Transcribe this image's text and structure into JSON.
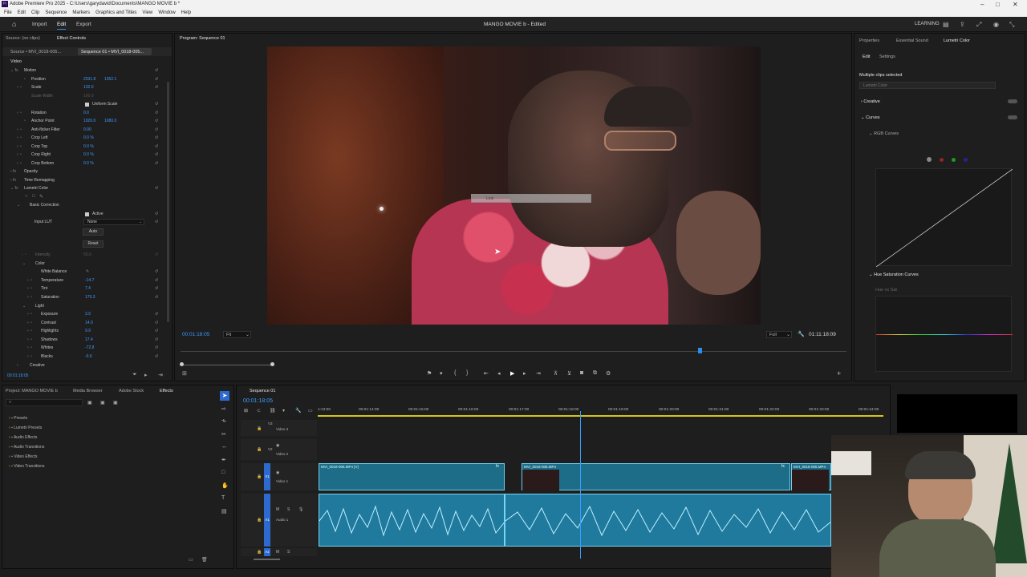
{
  "titlebar": {
    "title": "Adobe Premiere Pro 2025 - C:\\Users\\garydavid\\Documents\\MANGO MOVIE b *"
  },
  "menu": [
    "File",
    "Edit",
    "Clip",
    "Sequence",
    "Markers",
    "Graphics and Titles",
    "View",
    "Window",
    "Help"
  ],
  "appbar": {
    "import": "Import",
    "edit": "Edit",
    "export": "Export",
    "center_title": "MANGO MOVIE b - Edited",
    "learning": "LEARNING"
  },
  "source": {
    "tab_source": "Source: (no clips)",
    "tab_effects": "Effect Controls",
    "sub_source": "Source • MVI_0018-005...",
    "sub_seq": "Sequence 01 • MVI_0018-005...",
    "section_video": "Video"
  },
  "effects": {
    "motion": "Motion",
    "position": "Position",
    "position_x": "2331.8",
    "position_y": "1362.1",
    "scale": "Scale",
    "scale_val": "132.0",
    "scale_width": "Scale Width",
    "scale_width_val": "100.0",
    "uniform": "Uniform Scale",
    "rotation": "Rotation",
    "rotation_val": "0.0",
    "anchor": "Anchor Point",
    "anchor_x": "1920.0",
    "anchor_y": "1080.0",
    "flicker": "Anti-flicker Filter",
    "flicker_val": "0.00",
    "crop_left": "Crop Left",
    "crop_top": "Crop Top",
    "crop_right": "Crop Right",
    "crop_bottom": "Crop Bottom",
    "crop_val": "0.0 %",
    "opacity": "Opacity",
    "time_remap": "Time Remapping",
    "lumetri": "Lumetri Color",
    "basic": "Basic Correction",
    "active": "Active",
    "input_lut": "Input LUT",
    "lut_val": "None",
    "auto": "Auto",
    "reset": "Reset",
    "intensity": "Intensity",
    "intensity_val": "50.0",
    "color": "Color",
    "wb": "White Balance",
    "temperature": "Temperature",
    "temperature_val": "-14.7",
    "tint": "Tint",
    "tint_val": "7.4",
    "saturation": "Saturation",
    "saturation_val": "179.3",
    "light": "Light",
    "exposure": "Exposure",
    "exposure_val": "3.9",
    "contrast": "Contrast",
    "contrast_val": "14.0",
    "highlights": "Highlights",
    "highlights_val": "9.9",
    "shadows": "Shadows",
    "shadows_val": "17.4",
    "whites": "Whites",
    "whites_val": "-72.8",
    "blacks": "Blacks",
    "blacks_val": "-0.6",
    "creative": "Creative",
    "timecode": "00:01:18:05"
  },
  "program": {
    "tab": "Program: Sequence 01",
    "timecode": "00:01:18:05",
    "fit": "Fit",
    "full": "Full",
    "duration": "01:11:18:09",
    "tooltip": "Link"
  },
  "right": {
    "tab_properties": "Properties",
    "tab_essential": "Essential Sound",
    "tab_lumetri": "Lumetri Color",
    "sub_edit": "Edit",
    "sub_settings": "Settings",
    "multi": "Multiple clips selected",
    "dropdown": "Lumetri Color",
    "creative": "Creative",
    "curves": "Curves",
    "rgb": "RGB Curves",
    "hue_sat": "Hue Saturation Curves",
    "hue_vs_sat": "Hue vs Sat"
  },
  "project": {
    "tab_project": "Project: MANGO MOVIE b",
    "tab_media": "Media Browser",
    "tab_stock": "Adobe Stock",
    "tab_effects": "Effects",
    "items": [
      "Presets",
      "Lumetri Presets",
      "Audio Effects",
      "Audio Transitions",
      "Video Effects",
      "Video Transitions"
    ]
  },
  "timeline": {
    "tab": "Sequence 01",
    "timecode": "00:01:18:05",
    "ruler": [
      "1:13:00",
      "00:01:14:00",
      "00:01:15:00",
      "00:01:16:00",
      "00:01:17:00",
      "00:01:18:00",
      "00:01:19:00",
      "00:01:20:00",
      "00:01:21:00",
      "00:01:22:00",
      "00:01:23:00",
      "00:01:24:00"
    ],
    "v3": "V3",
    "v2": "V2",
    "v1": "V1",
    "a1": "A1",
    "a2": "A2",
    "v3_name": "Video 3",
    "v2_name": "Video 2",
    "v1_name": "Video 1",
    "a1_name": "Audio 1",
    "clip1": "MVI_0018-005.MP4 [V]",
    "clip2": "MVI_0018-005.MP4",
    "clip3": "MVI_0018-005.MP4"
  },
  "colors": {
    "accent": "#2d8ceb",
    "clip": "#1e6d88",
    "value": "#3a9cff"
  }
}
